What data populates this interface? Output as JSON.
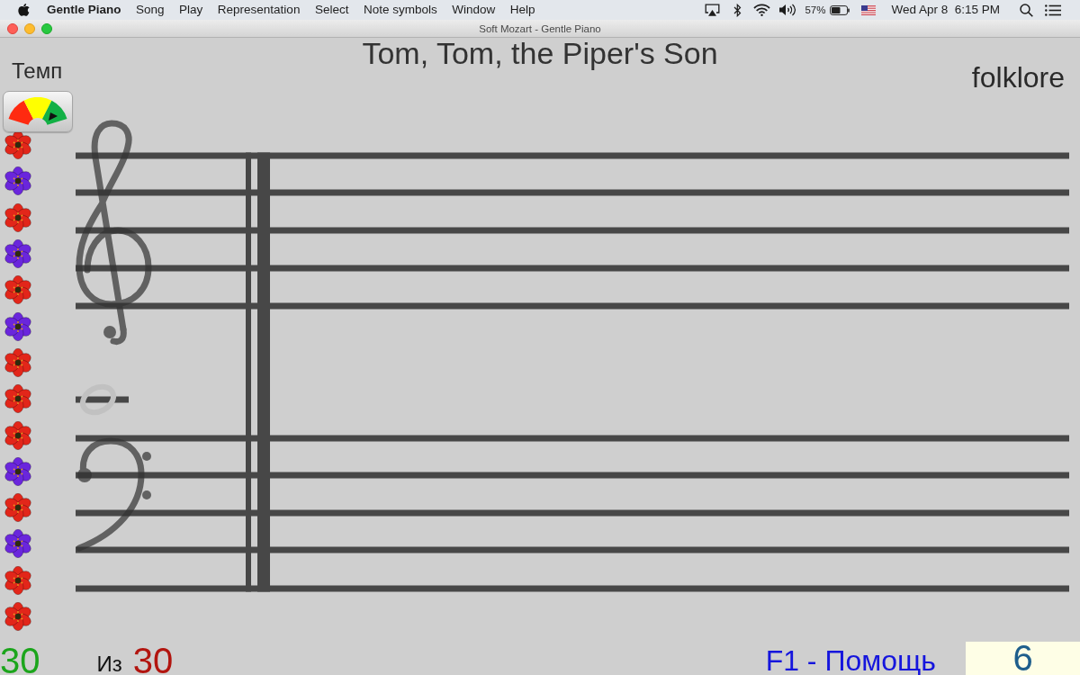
{
  "menu_bar": {
    "app_name": "Gentle Piano",
    "menus": [
      "Song",
      "Play",
      "Representation",
      "Select",
      "Note symbols",
      "Window",
      "Help"
    ],
    "battery_percent": "57%",
    "clock": "Wed Apr 8  6:15 PM"
  },
  "window": {
    "title": "Soft Mozart - Gentle Piano"
  },
  "song": {
    "title": "Tom, Tom, the Piper's Son",
    "source": "folklore"
  },
  "tempo": {
    "label": "Темп"
  },
  "flowers": [
    {
      "color": "#e2261a"
    },
    {
      "color": "#6a26dc"
    },
    {
      "color": "#e2261a"
    },
    {
      "color": "#6a26dc"
    },
    {
      "color": "#e2261a"
    },
    {
      "color": "#6a26dc"
    },
    {
      "color": "#e2261a"
    },
    {
      "color": "#e2261a"
    },
    {
      "color": "#e2261a"
    },
    {
      "color": "#6a26dc"
    },
    {
      "color": "#e2261a"
    },
    {
      "color": "#6a26dc"
    },
    {
      "color": "#e2261a"
    },
    {
      "color": "#e2261a"
    }
  ],
  "footer": {
    "correct": "30",
    "of_label": "Из",
    "total": "30",
    "help": "F1 - Помощь",
    "counter": "6"
  }
}
